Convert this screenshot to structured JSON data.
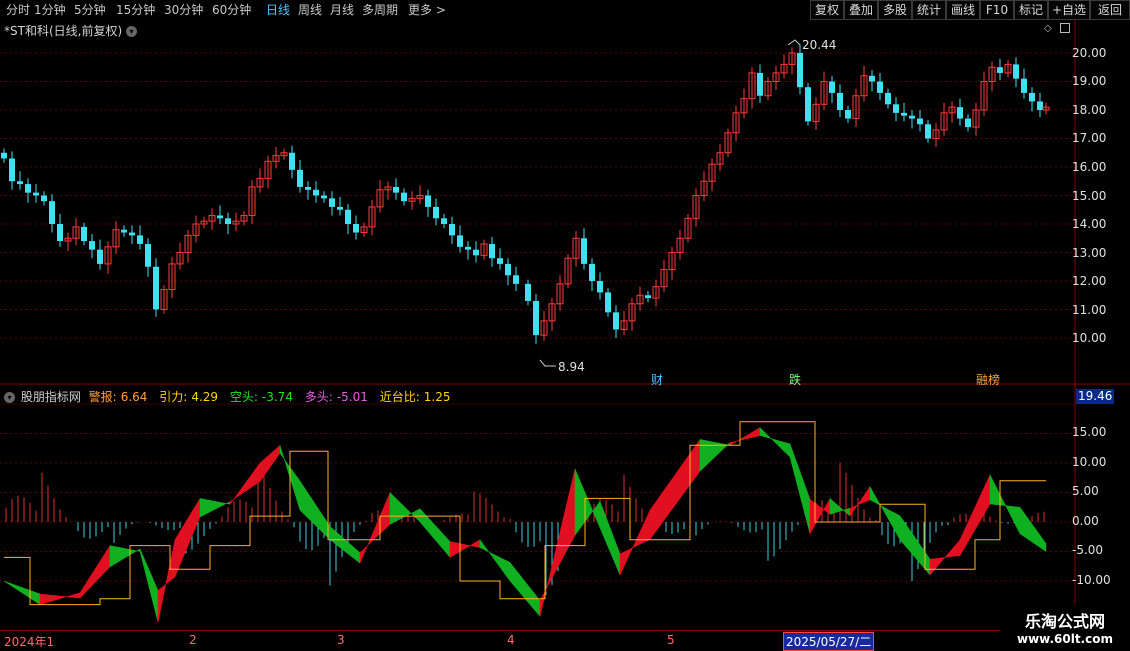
{
  "toolbar": {
    "periods": [
      "分时",
      "1分钟",
      "5分钟",
      "15分钟",
      "30分钟",
      "60分钟",
      "日线",
      "周线",
      "月线",
      "多周期",
      "更多 >"
    ],
    "active_period": "日线",
    "right_buttons": [
      "复权",
      "叠加",
      "多股",
      "统计",
      "画线",
      "F10",
      "标记",
      "+自选",
      "返回"
    ]
  },
  "chart_title": "*ST和科(日线,前复权)",
  "main_axis": [
    "20.00",
    "19.00",
    "18.00",
    "17.00",
    "16.00",
    "15.00",
    "14.00",
    "13.00",
    "12.00",
    "11.00",
    "10.00"
  ],
  "high_label": "20.44",
  "low_label": "8.94",
  "event_tags": [
    {
      "text": "财",
      "color": "#4fc3ff"
    },
    {
      "text": "跌",
      "color": "#7dff7d"
    },
    {
      "text": "融榜",
      "color": "#ff9f43"
    }
  ],
  "indicator": {
    "name": "股朋指标网",
    "values": [
      {
        "label": "警报:",
        "value": "6.64",
        "color": "#ff9f43"
      },
      {
        "label": "引力:",
        "value": "4.29",
        "color": "#ffd700"
      },
      {
        "label": "空头:",
        "value": "-3.74",
        "color": "#22e022"
      },
      {
        "label": "多头:",
        "value": "-5.01",
        "color": "#e060e0"
      },
      {
        "label": "近台比:",
        "value": "1.25",
        "color": "#ffd700"
      }
    ]
  },
  "ind_axis": [
    "15.00",
    "10.00",
    "5.00",
    "0.00",
    "-5.00",
    "-10.00"
  ],
  "ind_badge": "19.46",
  "bottom": {
    "year": "2024年1",
    "months": [
      "2",
      "3",
      "4",
      "5"
    ],
    "cursor_date": "2025/05/27/二"
  },
  "watermark": {
    "title": "乐淘公式网",
    "url": "www.60lt.com"
  }
}
